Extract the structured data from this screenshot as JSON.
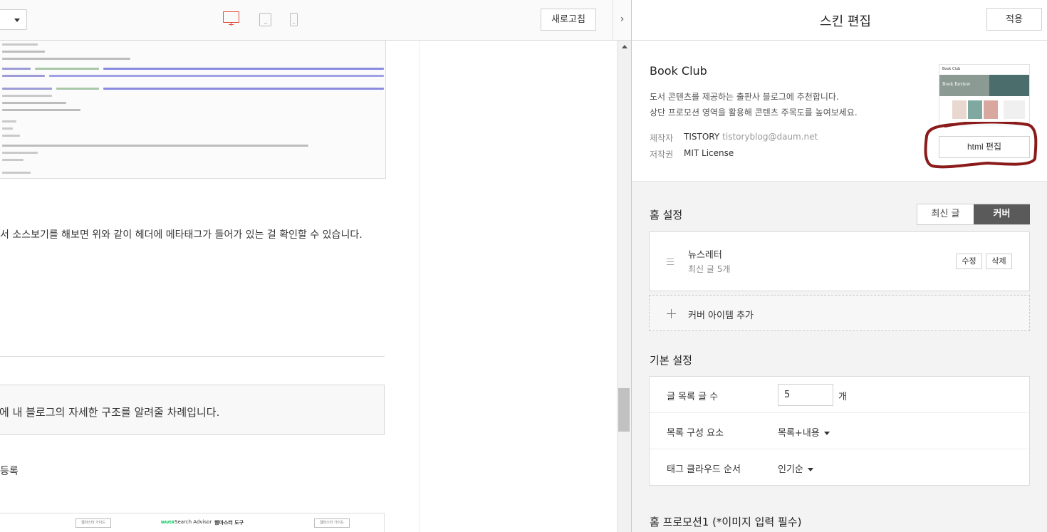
{
  "toolbar": {
    "refresh_label": "새로고침",
    "collapse_glyph": "›",
    "device_icons": [
      "desktop-icon",
      "tablet-icon",
      "mobile-icon"
    ],
    "active_device": "desktop"
  },
  "preview": {
    "paragraph_1": "서 소스보기를 해보면 위와 같이 헤더에 메타태그가 들어가 있는 걸 확인할 수 있습니다.",
    "quote_text": "에 내 블로그의 자세한 구조를 알려줄 차례입니다.",
    "paragraph_2": "등록",
    "embedded_image": {
      "button_left": "웹마스터 가이드",
      "brand": "NAVER",
      "search_advisor": "Search Advisor",
      "tool_label": "웹마스터 도구",
      "button_right": "웹마스터 가이드"
    }
  },
  "editor": {
    "title": "스킨 편집",
    "apply_label": "적용",
    "skin": {
      "name": "Book Club",
      "desc_line1": "도서 콘텐츠를 제공하는 출판사 블로그에 추천합니다.",
      "desc_line2": "상단 프로모션 영역을 활용해 콘텐츠 주목도를 높여보세요.",
      "maker_label": "제작자",
      "maker_value": "TISTORY",
      "maker_email": "tistoryblog@daum.net",
      "license_label": "저작권",
      "license_value": "MIT License",
      "thumbnail_brand": "Book Club",
      "thumbnail_caption": "Book Review",
      "html_edit_label": "html 편집"
    },
    "home_settings": {
      "title": "홈 설정",
      "tab_recent": "최신 글",
      "tab_cover": "커버",
      "active_tab": "커버",
      "cover_item": {
        "name": "뉴스레터",
        "sub": "최신 글 5개",
        "edit_label": "수정",
        "delete_label": "삭제"
      },
      "add_cover_label": "커버 아이템 추가"
    },
    "basic_settings": {
      "title": "기본 설정",
      "rows": [
        {
          "label": "글 목록 글 수",
          "value": "5",
          "unit": "개"
        },
        {
          "label": "목록 구성 요소",
          "value": "목록+내용"
        },
        {
          "label": "태그 클라우드 순서",
          "value": "인기순"
        }
      ]
    },
    "home_promo_title": "홈 프로모션1 (*이미지 입력 필수)"
  },
  "colors": {
    "active_device": "#e34a3b",
    "tab_active_bg": "#5a5a5a",
    "annotation": "#8b1a1a"
  }
}
